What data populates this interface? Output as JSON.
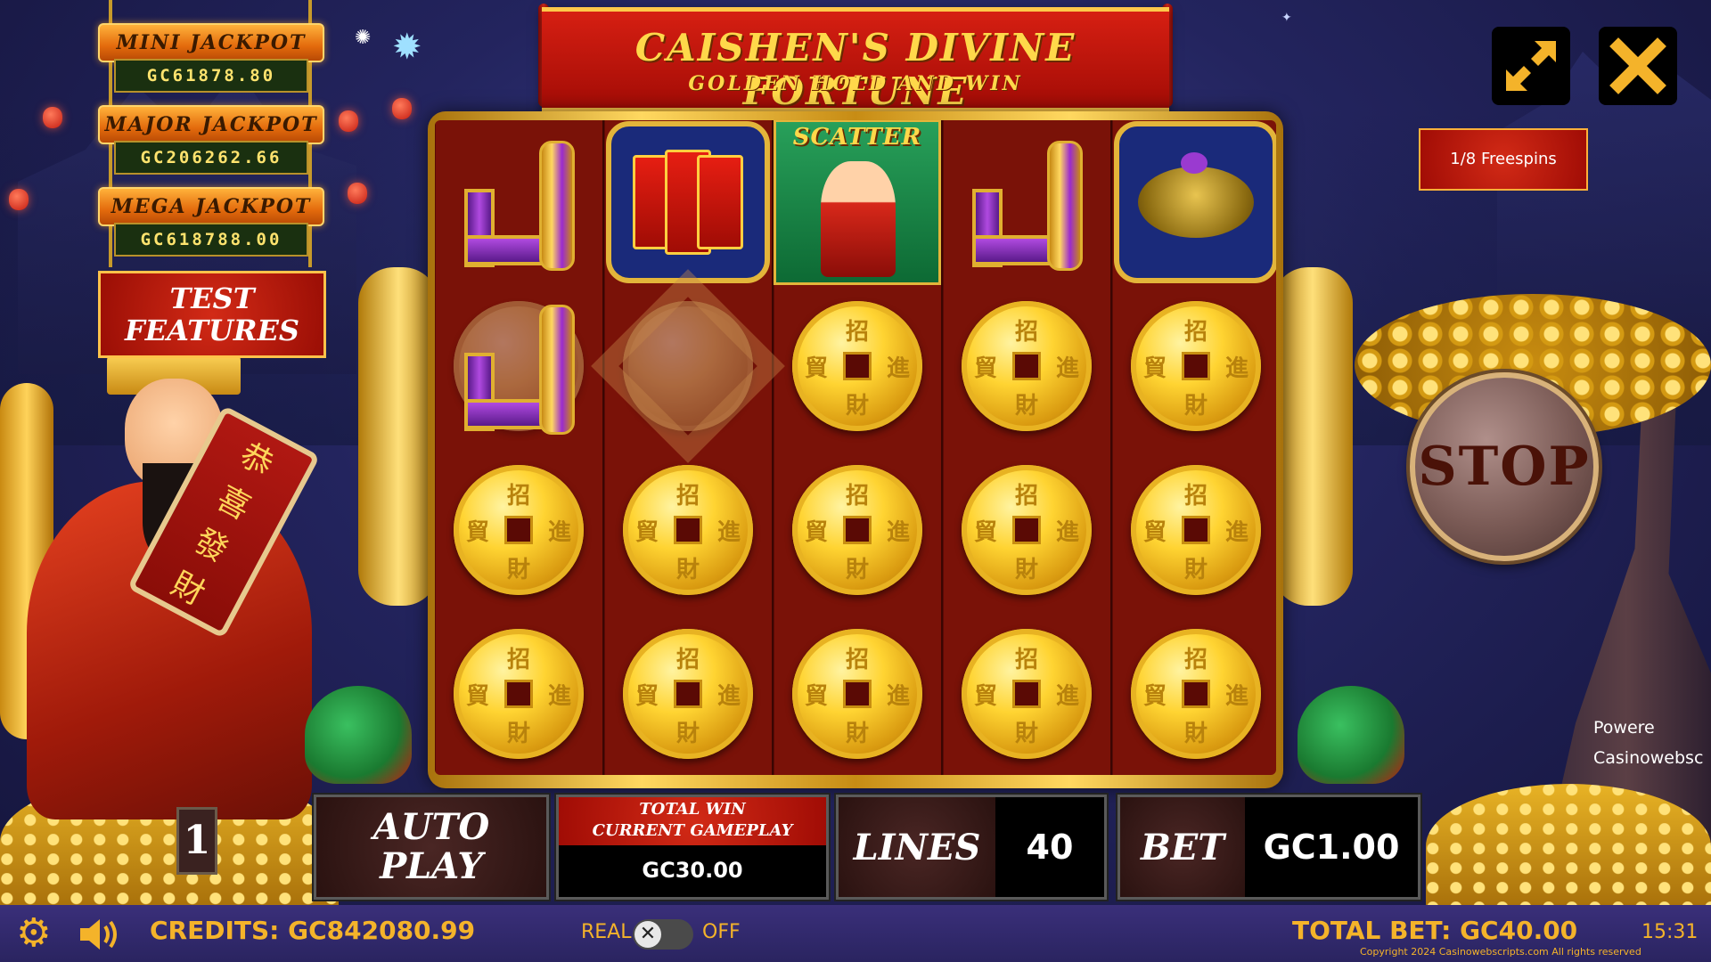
{
  "game": {
    "title": "CAISHEN'S DIVINE FORTUNE",
    "subtitle": "GOLDEN HOLD AND WIN"
  },
  "jackpots": [
    {
      "label": "MINI JACKPOT",
      "value": "GC61878.80"
    },
    {
      "label": "MAJOR JACKPOT",
      "value": "GC206262.66"
    },
    {
      "label": "MEGA JACKPOT",
      "value": "GC618788.00"
    }
  ],
  "test_features_label": "TEST\nFEATURES",
  "icons": {
    "fullscreen": "fullscreen-arrows-icon",
    "close": "close-x-icon",
    "settings": "gear-icon",
    "sound": "speaker-icon",
    "toggle": "x-icon"
  },
  "freespins": "1/8 Freespins",
  "scatter_label": "SCATTER",
  "stop_label": "STOP",
  "powered_by": {
    "line1": "Powere",
    "line2": "Casinowebsc"
  },
  "controls": {
    "line_number": "1",
    "autoplay_label": "AUTO\nPLAY",
    "total_win_label": "TOTAL WIN\nCURRENT GAMEPLAY",
    "total_win_value": "GC30.00",
    "lines_label": "LINES",
    "lines_value": "40",
    "bet_label": "BET",
    "bet_value": "GC1.00"
  },
  "status": {
    "credits": "CREDITS: GC842080.99",
    "real": "REAL",
    "off": "OFF",
    "total_bet": "TOTAL BET: GC40.00",
    "time": "15:31",
    "copyright": "Copyright 2024 Casinowebscripts.com All rights reserved"
  },
  "reels": [
    [
      "L-symbol",
      "L-symbol-dim",
      "coin",
      "coin"
    ],
    [
      "envelopes",
      "ghost-symbol",
      "coin",
      "coin"
    ],
    [
      "scatter",
      "coin",
      "coin",
      "coin"
    ],
    [
      "L-symbol",
      "coin",
      "coin",
      "coin"
    ],
    [
      "turtle",
      "coin",
      "coin",
      "coin"
    ]
  ],
  "colors": {
    "accent_gold": "#f4b32a",
    "banner_red": "#d61f12",
    "background_night": "#23245e"
  }
}
